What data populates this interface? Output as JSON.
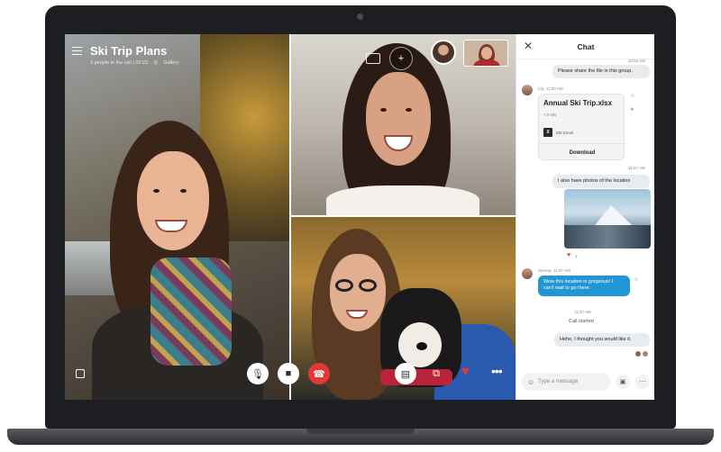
{
  "call": {
    "title": "Ski Trip Plans",
    "subtitle": "3 people in the call | 02:23",
    "gallery_label": "Gallery"
  },
  "controls": {
    "mic": "🎙",
    "video": "■",
    "hangup": "☎",
    "chat": "▤",
    "switch": "⧉",
    "heart": "♥",
    "more": "•••"
  },
  "chat": {
    "title": "Chat",
    "close": "✕",
    "messages": {
      "t1": "10:53 AM",
      "m1": "Please share the file in this group.",
      "sender1": "Lily, 11:00 AM",
      "file_name": "Annual Ski Trip.xlsx",
      "file_size": "7.6 MB",
      "file_type": "MS Excel",
      "file_action": "Download",
      "t2": "11:07 AM",
      "m2": "I also have photos of the location",
      "reaction_count": "1",
      "sender2": "Serena, 11:37 AM",
      "m3": "Wow this location is gorgeous! I can't wait to go there.",
      "t3": "11:37 AM",
      "system": "Call started",
      "m4": "Hehe, I thought you would like it."
    },
    "compose_placeholder": "Type a message"
  },
  "colors": {
    "accent": "#2196d3",
    "hangup": "#e23838"
  }
}
